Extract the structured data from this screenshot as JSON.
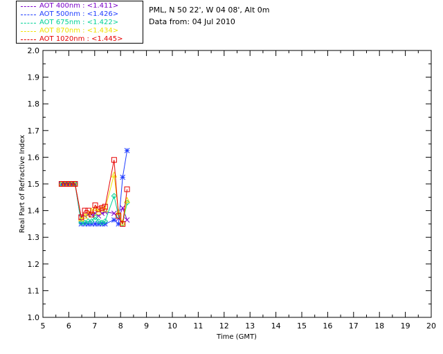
{
  "legend": [
    {
      "label": "AOT  400nm : <1.411>",
      "color": "#7a00c8"
    },
    {
      "label": "AOT  500nm : <1.426>",
      "color": "#1e3cff"
    },
    {
      "label": "AOT  675nm : <1.422>",
      "color": "#00d296"
    },
    {
      "label": "AOT  870nm : <1.434>",
      "color": "#f0e100"
    },
    {
      "label": "AOT 1020nm : <1.445>",
      "color": "#e60000"
    }
  ],
  "site": {
    "line1": "PML, N 50 22', W 04 08', Alt 0m",
    "line2": "Data from: 04 Jul 2010"
  },
  "chart_data": {
    "type": "line",
    "xlabel": "Time (GMT)",
    "ylabel": "Real Part of Refractive Index",
    "xlim": [
      5,
      20
    ],
    "ylim": [
      1.0,
      2.0
    ],
    "xticks": [
      5,
      6,
      7,
      8,
      9,
      10,
      11,
      12,
      13,
      14,
      15,
      16,
      17,
      18,
      19,
      20
    ],
    "yticks": [
      "1.0",
      "1.1",
      "1.2",
      "1.3",
      "1.4",
      "1.5",
      "1.6",
      "1.7",
      "1.8",
      "1.9",
      "2.0"
    ],
    "series": [
      {
        "name": "AOT 400nm",
        "color": "#7a00c8",
        "marker": "x",
        "points": [
          [
            5.72,
            1.5
          ],
          [
            5.85,
            1.5
          ],
          [
            5.98,
            1.5
          ],
          [
            6.1,
            1.5
          ],
          [
            6.24,
            1.5
          ],
          [
            6.48,
            1.375
          ],
          [
            6.62,
            1.38
          ],
          [
            6.75,
            1.385
          ],
          [
            6.88,
            1.385
          ],
          [
            7.02,
            1.39
          ],
          [
            7.15,
            1.38
          ],
          [
            7.28,
            1.39
          ],
          [
            7.4,
            1.395
          ],
          [
            7.75,
            1.39
          ],
          [
            7.92,
            1.37
          ],
          [
            8.08,
            1.41
          ],
          [
            8.25,
            1.365
          ]
        ]
      },
      {
        "name": "AOT 500nm",
        "color": "#1e3cff",
        "marker": "asterisk",
        "points": [
          [
            5.72,
            1.5
          ],
          [
            5.85,
            1.5
          ],
          [
            5.98,
            1.5
          ],
          [
            6.1,
            1.5
          ],
          [
            6.24,
            1.5
          ],
          [
            6.48,
            1.35
          ],
          [
            6.62,
            1.35
          ],
          [
            6.75,
            1.35
          ],
          [
            6.88,
            1.35
          ],
          [
            7.02,
            1.35
          ],
          [
            7.15,
            1.35
          ],
          [
            7.28,
            1.35
          ],
          [
            7.4,
            1.35
          ],
          [
            7.75,
            1.365
          ],
          [
            7.92,
            1.35
          ],
          [
            8.08,
            1.525
          ],
          [
            8.25,
            1.625
          ]
        ]
      },
      {
        "name": "AOT 675nm",
        "color": "#00d296",
        "marker": "diamond",
        "points": [
          [
            5.72,
            1.5
          ],
          [
            5.85,
            1.5
          ],
          [
            5.98,
            1.5
          ],
          [
            6.1,
            1.5
          ],
          [
            6.24,
            1.5
          ],
          [
            6.48,
            1.355
          ],
          [
            6.62,
            1.355
          ],
          [
            6.75,
            1.36
          ],
          [
            6.88,
            1.36
          ],
          [
            7.02,
            1.375
          ],
          [
            7.15,
            1.36
          ],
          [
            7.28,
            1.355
          ],
          [
            7.4,
            1.36
          ],
          [
            7.75,
            1.455
          ],
          [
            7.92,
            1.38
          ],
          [
            8.08,
            1.35
          ],
          [
            8.25,
            1.43
          ]
        ]
      },
      {
        "name": "AOT 870nm",
        "color": "#f0e100",
        "marker": "triangle",
        "points": [
          [
            5.72,
            1.5
          ],
          [
            5.85,
            1.5
          ],
          [
            5.98,
            1.5
          ],
          [
            6.1,
            1.5
          ],
          [
            6.24,
            1.5
          ],
          [
            6.48,
            1.37
          ],
          [
            6.62,
            1.38
          ],
          [
            6.75,
            1.39
          ],
          [
            6.88,
            1.4
          ],
          [
            7.02,
            1.41
          ],
          [
            7.15,
            1.395
          ],
          [
            7.28,
            1.41
          ],
          [
            7.4,
            1.405
          ],
          [
            7.75,
            1.535
          ],
          [
            7.92,
            1.395
          ],
          [
            8.08,
            1.355
          ],
          [
            8.25,
            1.44
          ]
        ]
      },
      {
        "name": "AOT 1020nm",
        "color": "#e60000",
        "marker": "square",
        "points": [
          [
            5.72,
            1.5
          ],
          [
            5.85,
            1.5
          ],
          [
            5.98,
            1.5
          ],
          [
            6.1,
            1.5
          ],
          [
            6.24,
            1.5
          ],
          [
            6.48,
            1.375
          ],
          [
            6.62,
            1.4
          ],
          [
            6.75,
            1.4
          ],
          [
            6.88,
            1.385
          ],
          [
            7.02,
            1.42
          ],
          [
            7.15,
            1.405
          ],
          [
            7.28,
            1.41
          ],
          [
            7.4,
            1.415
          ],
          [
            7.75,
            1.59
          ],
          [
            7.92,
            1.38
          ],
          [
            8.08,
            1.35
          ],
          [
            8.25,
            1.48
          ]
        ]
      }
    ]
  }
}
